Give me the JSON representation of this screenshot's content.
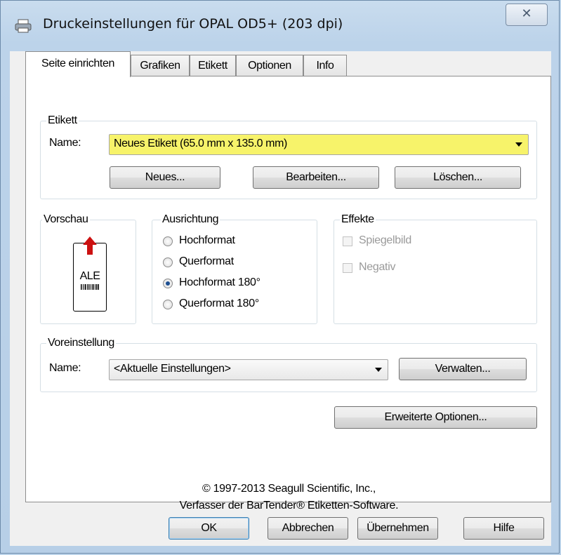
{
  "window": {
    "title": "Druckeinstellungen für OPAL OD5+ (203 dpi)",
    "close_glyph": "✕"
  },
  "tabs": [
    {
      "label": "Seite einrichten",
      "active": true
    },
    {
      "label": "Grafiken",
      "active": false
    },
    {
      "label": "Etikett",
      "active": false
    },
    {
      "label": "Optionen",
      "active": false
    },
    {
      "label": "Info",
      "active": false
    }
  ],
  "etikett": {
    "group_label": "Etikett",
    "name_label": "Name:",
    "name_value": "Neues Etikett (65.0 mm x 135.0 mm)",
    "highlight_color": "#f7f36a",
    "buttons": {
      "new": "Neues...",
      "edit": "Bearbeiten...",
      "delete": "Löschen..."
    }
  },
  "preview": {
    "group_label": "Vorschau",
    "text": "ALE",
    "arrow_color": "#cc1111"
  },
  "ausrichtung": {
    "group_label": "Ausrichtung",
    "options": [
      {
        "label": "Hochformat",
        "selected": false
      },
      {
        "label": "Querformat",
        "selected": false
      },
      {
        "label": "Hochformat 180°",
        "selected": true
      },
      {
        "label": "Querformat 180°",
        "selected": false
      }
    ]
  },
  "effekte": {
    "group_label": "Effekte",
    "options": [
      {
        "label": "Spiegelbild",
        "checked": false,
        "disabled": true
      },
      {
        "label": "Negativ",
        "checked": false,
        "disabled": true
      }
    ]
  },
  "voreinstellung": {
    "group_label": "Voreinstellung",
    "name_label": "Name:",
    "name_value": "<Aktuelle Einstellungen>",
    "manage_button": "Verwalten..."
  },
  "advanced_button": "Erweiterte Optionen...",
  "copyright": {
    "line1": "© 1997-2013 Seagull Scientific, Inc.,",
    "line2": "Verfasser der BarTender® Etiketten-Software."
  },
  "footer": {
    "ok": "OK",
    "cancel": "Abbrechen",
    "apply": "Übernehmen",
    "help": "Hilfe"
  }
}
